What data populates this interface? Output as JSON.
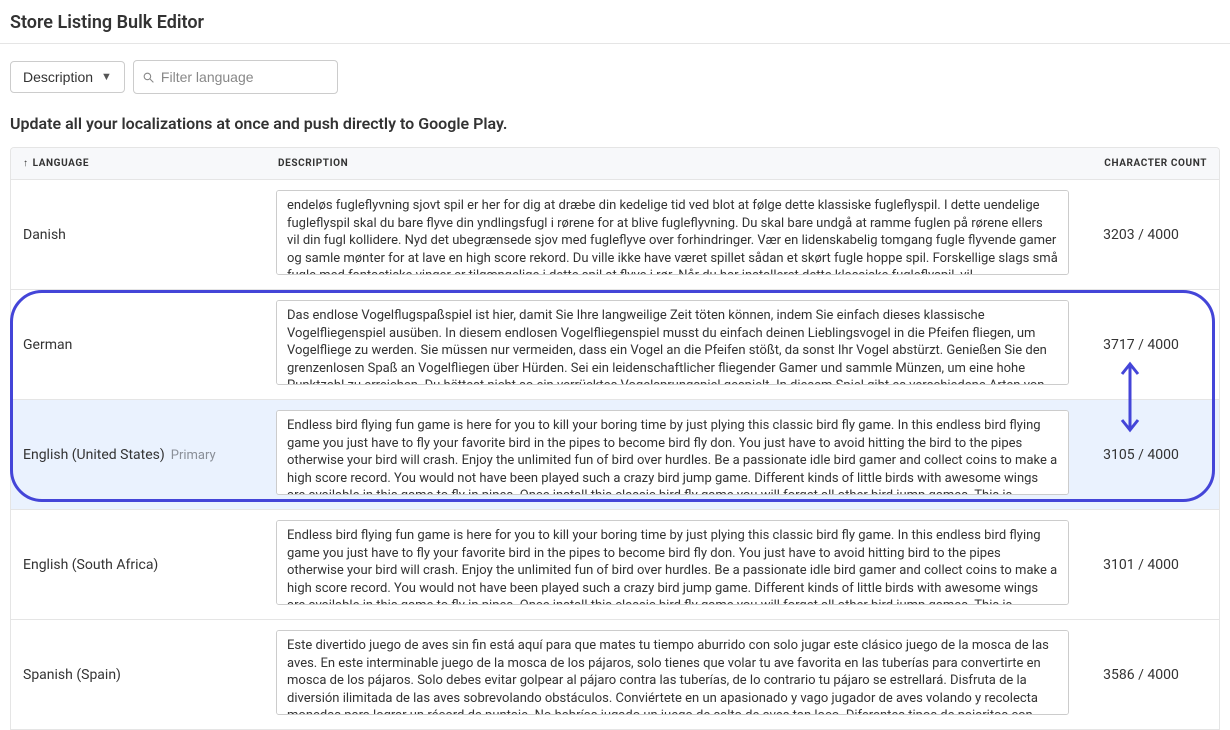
{
  "pageTitle": "Store Listing Bulk Editor",
  "toolbar": {
    "dropdownLabel": "Description",
    "filterPlaceholder": "Filter language"
  },
  "subtitle": "Update all your localizations at once and push directly to Google Play.",
  "columns": {
    "language": "Language",
    "description": "Description",
    "count": "Character Count"
  },
  "countMax": "4000",
  "primaryTag": "Primary",
  "rows": [
    {
      "language": "Danish",
      "count": "3203 / 4000",
      "highlight": false,
      "primary": false,
      "description": "endeløs fugleflyvning sjovt spil er her for dig at dræbe din kedelige tid ved blot at følge dette klassiske fugleflyspil. I dette uendelige fugleflyspil skal du bare flyve din yndlingsfugl i rørene for at blive fugleflyvning. Du skal bare undgå at ramme fuglen på rørene ellers vil din fugl kollidere. Nyd det ubegrænsede sjov med fugleflyve over forhindringer. Vær en lidenskabelig tomgang fugle flyvende gamer og samle mønter for at lave en high score rekord. Du ville ikke have været spillet sådan et skørt fugle hoppe spil. Forskellige slags små fugle med fantastiske vinger er tilgængelige i dette spil at flyve i rør. Når du har installeret dette klassiske fugleflyspil, vil"
    },
    {
      "language": "German",
      "count": "3717 / 4000",
      "highlight": false,
      "primary": false,
      "description": "Das endlose Vogelflugspaßspiel ist hier, damit Sie Ihre langweilige Zeit töten können, indem Sie einfach dieses klassische Vogelfliegenspiel ausüben. In diesem endlosen Vogelfliegenspiel musst du einfach deinen Lieblingsvogel in die Pfeifen fliegen, um Vogelfliege zu werden. Sie müssen nur vermeiden, dass ein Vogel an die Pfeifen stößt, da sonst Ihr Vogel abstürzt. Genießen Sie den grenzenlosen Spaß an Vogelfliegen über Hürden. Sei ein leidenschaftlicher fliegender Gamer und sammle Münzen, um eine hohe Punktzahl zu erreichen. Du hättest nicht so ein verrücktes Vogelsprungspiel gespielt. In diesem Spiel gibt es verschiedene Arten von"
    },
    {
      "language": "English (United States)",
      "count": "3105 / 4000",
      "highlight": true,
      "primary": true,
      "description": "Endless bird flying fun game is here for you to kill your boring time by just plying this classic bird fly game. In this endless bird flying game you just have to fly your favorite bird in the pipes to become bird fly don. You just have to avoid hitting the bird to the pipes otherwise your bird will crash. Enjoy the unlimited fun of bird over hurdles. Be a passionate idle bird gamer and collect coins to make a high score record. You would not have been played such a crazy bird jump game. Different kinds of little birds with awesome wings are available in this game to fly in pipes. Once install this classic bird fly game you will forget all other bird jump games. This is"
    },
    {
      "language": "English (South Africa)",
      "count": "3101 / 4000",
      "highlight": false,
      "primary": false,
      "description": "Endless bird flying fun game is here for you to kill your boring time by just plying this classic bird fly game. In this endless bird flying game you just have to fly your favorite bird in the pipes to become bird fly don. You just have to avoid hitting bird to the pipes otherwise your bird will crash. Enjoy the unlimited fun of bird over hurdles. Be a passionate idle bird gamer and collect coins to make a high score record. You would not have been played such a crazy bird jump game. Different kinds of little birds with awesome wings are available in this game to fly in pipes. Once install this classic bird fly game you will forget all other bird jump games. This is"
    },
    {
      "language": "Spanish (Spain)",
      "count": "3586 / 4000",
      "highlight": false,
      "primary": false,
      "description": "Este divertido juego de aves sin fin está aquí para que mates tu tiempo aburrido con solo jugar este clásico juego de la mosca de las aves. En este interminable juego de la mosca de los pájaros, solo tienes que volar tu ave favorita en las tuberías para convertirte en mosca de los pájaros. Solo debes evitar golpear al pájaro contra las tuberías, de lo contrario tu pájaro se estrellará. Disfruta de la diversión ilimitada de las aves sobrevolando obstáculos. Conviértete en un apasionado y vago jugador de aves volando y recolecta monedas para lograr un récord de puntaje. No habrías jugado un juego de salto de aves tan loco. Diferentes tipos de pajaritos con"
    }
  ]
}
